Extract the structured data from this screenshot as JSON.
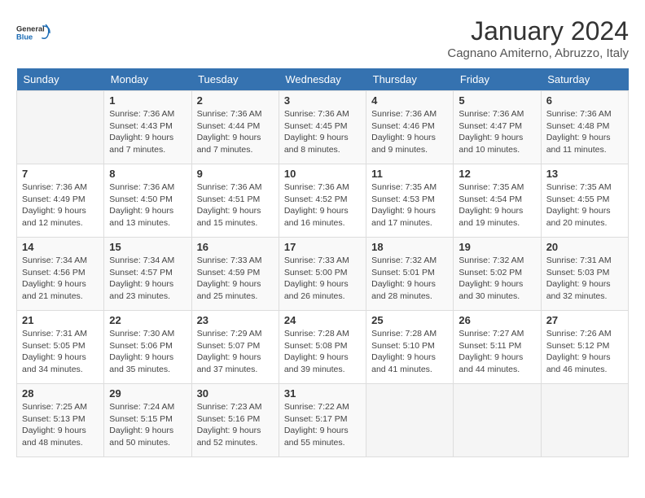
{
  "header": {
    "logo_general": "General",
    "logo_blue": "Blue",
    "month": "January 2024",
    "location": "Cagnano Amiterno, Abruzzo, Italy"
  },
  "columns": [
    "Sunday",
    "Monday",
    "Tuesday",
    "Wednesday",
    "Thursday",
    "Friday",
    "Saturday"
  ],
  "weeks": [
    [
      {
        "day": "",
        "info": ""
      },
      {
        "day": "1",
        "info": "Sunrise: 7:36 AM\nSunset: 4:43 PM\nDaylight: 9 hours\nand 7 minutes."
      },
      {
        "day": "2",
        "info": "Sunrise: 7:36 AM\nSunset: 4:44 PM\nDaylight: 9 hours\nand 7 minutes."
      },
      {
        "day": "3",
        "info": "Sunrise: 7:36 AM\nSunset: 4:45 PM\nDaylight: 9 hours\nand 8 minutes."
      },
      {
        "day": "4",
        "info": "Sunrise: 7:36 AM\nSunset: 4:46 PM\nDaylight: 9 hours\nand 9 minutes."
      },
      {
        "day": "5",
        "info": "Sunrise: 7:36 AM\nSunset: 4:47 PM\nDaylight: 9 hours\nand 10 minutes."
      },
      {
        "day": "6",
        "info": "Sunrise: 7:36 AM\nSunset: 4:48 PM\nDaylight: 9 hours\nand 11 minutes."
      }
    ],
    [
      {
        "day": "7",
        "info": "Sunrise: 7:36 AM\nSunset: 4:49 PM\nDaylight: 9 hours\nand 12 minutes."
      },
      {
        "day": "8",
        "info": "Sunrise: 7:36 AM\nSunset: 4:50 PM\nDaylight: 9 hours\nand 13 minutes."
      },
      {
        "day": "9",
        "info": "Sunrise: 7:36 AM\nSunset: 4:51 PM\nDaylight: 9 hours\nand 15 minutes."
      },
      {
        "day": "10",
        "info": "Sunrise: 7:36 AM\nSunset: 4:52 PM\nDaylight: 9 hours\nand 16 minutes."
      },
      {
        "day": "11",
        "info": "Sunrise: 7:35 AM\nSunset: 4:53 PM\nDaylight: 9 hours\nand 17 minutes."
      },
      {
        "day": "12",
        "info": "Sunrise: 7:35 AM\nSunset: 4:54 PM\nDaylight: 9 hours\nand 19 minutes."
      },
      {
        "day": "13",
        "info": "Sunrise: 7:35 AM\nSunset: 4:55 PM\nDaylight: 9 hours\nand 20 minutes."
      }
    ],
    [
      {
        "day": "14",
        "info": "Sunrise: 7:34 AM\nSunset: 4:56 PM\nDaylight: 9 hours\nand 21 minutes."
      },
      {
        "day": "15",
        "info": "Sunrise: 7:34 AM\nSunset: 4:57 PM\nDaylight: 9 hours\nand 23 minutes."
      },
      {
        "day": "16",
        "info": "Sunrise: 7:33 AM\nSunset: 4:59 PM\nDaylight: 9 hours\nand 25 minutes."
      },
      {
        "day": "17",
        "info": "Sunrise: 7:33 AM\nSunset: 5:00 PM\nDaylight: 9 hours\nand 26 minutes."
      },
      {
        "day": "18",
        "info": "Sunrise: 7:32 AM\nSunset: 5:01 PM\nDaylight: 9 hours\nand 28 minutes."
      },
      {
        "day": "19",
        "info": "Sunrise: 7:32 AM\nSunset: 5:02 PM\nDaylight: 9 hours\nand 30 minutes."
      },
      {
        "day": "20",
        "info": "Sunrise: 7:31 AM\nSunset: 5:03 PM\nDaylight: 9 hours\nand 32 minutes."
      }
    ],
    [
      {
        "day": "21",
        "info": "Sunrise: 7:31 AM\nSunset: 5:05 PM\nDaylight: 9 hours\nand 34 minutes."
      },
      {
        "day": "22",
        "info": "Sunrise: 7:30 AM\nSunset: 5:06 PM\nDaylight: 9 hours\nand 35 minutes."
      },
      {
        "day": "23",
        "info": "Sunrise: 7:29 AM\nSunset: 5:07 PM\nDaylight: 9 hours\nand 37 minutes."
      },
      {
        "day": "24",
        "info": "Sunrise: 7:28 AM\nSunset: 5:08 PM\nDaylight: 9 hours\nand 39 minutes."
      },
      {
        "day": "25",
        "info": "Sunrise: 7:28 AM\nSunset: 5:10 PM\nDaylight: 9 hours\nand 41 minutes."
      },
      {
        "day": "26",
        "info": "Sunrise: 7:27 AM\nSunset: 5:11 PM\nDaylight: 9 hours\nand 44 minutes."
      },
      {
        "day": "27",
        "info": "Sunrise: 7:26 AM\nSunset: 5:12 PM\nDaylight: 9 hours\nand 46 minutes."
      }
    ],
    [
      {
        "day": "28",
        "info": "Sunrise: 7:25 AM\nSunset: 5:13 PM\nDaylight: 9 hours\nand 48 minutes."
      },
      {
        "day": "29",
        "info": "Sunrise: 7:24 AM\nSunset: 5:15 PM\nDaylight: 9 hours\nand 50 minutes."
      },
      {
        "day": "30",
        "info": "Sunrise: 7:23 AM\nSunset: 5:16 PM\nDaylight: 9 hours\nand 52 minutes."
      },
      {
        "day": "31",
        "info": "Sunrise: 7:22 AM\nSunset: 5:17 PM\nDaylight: 9 hours\nand 55 minutes."
      },
      {
        "day": "",
        "info": ""
      },
      {
        "day": "",
        "info": ""
      },
      {
        "day": "",
        "info": ""
      }
    ]
  ]
}
